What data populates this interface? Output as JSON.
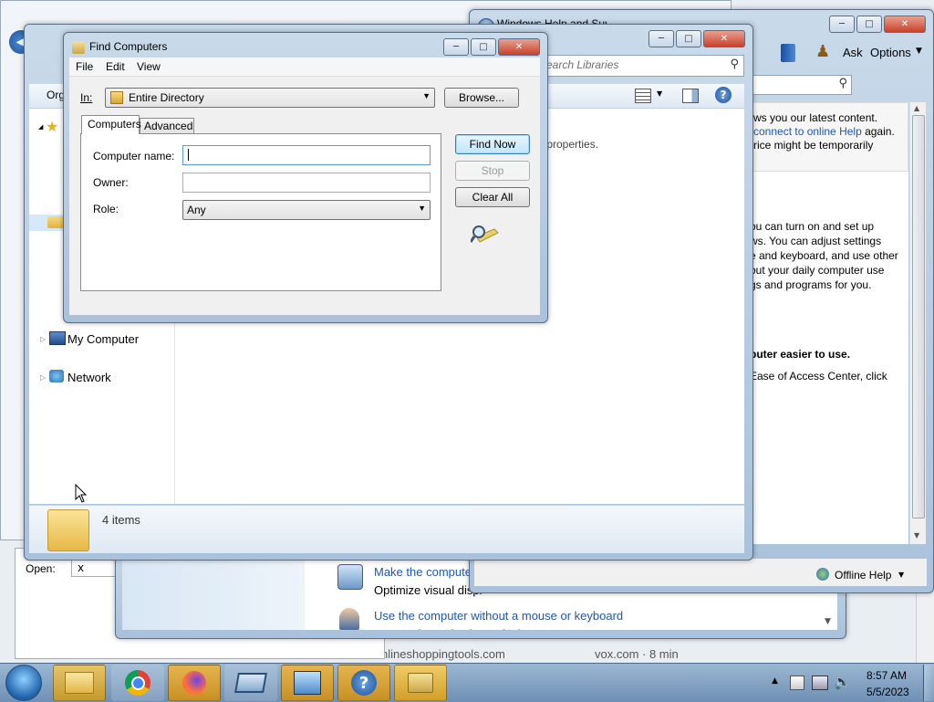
{
  "desktop": {
    "bottom_left_text": "nlineshoppingtools.com",
    "bottom_mid_text": "vox.com · 8 min"
  },
  "run_dialog": {
    "open_label": "Open:",
    "open_value": "x"
  },
  "help_window": {
    "title": "Windows Help and Support",
    "ask_label": "Ask",
    "options_label": "Options",
    "offline_label": "Offline Help",
    "lines": [
      "ws you our latest content.",
      "connect to online Help",
      " again.",
      "rice might be temporarily",
      "ou can turn on and set up",
      "ws. You can adjust settings",
      "e and keyboard, and use other",
      "out your daily computer use",
      "gs and programs for you.",
      "puter easier to use.",
      "Ease of Access Center, click"
    ]
  },
  "ease_window": {
    "items": [
      {
        "link": "Make the computer",
        "desc": "Optimize visual displ"
      },
      {
        "link": "Use the computer without a mouse or keyboard",
        "desc": "Set up alternative input devices"
      }
    ]
  },
  "explorer": {
    "search_placeholder": "Search Libraries",
    "organize_label": "Org",
    "properties_text": "r properties.",
    "tree": [
      {
        "label": "My Computer"
      },
      {
        "label": "Network"
      }
    ],
    "status_text": "4 items"
  },
  "find_dialog": {
    "title": "Find Computers",
    "menu": [
      "File",
      "Edit",
      "View"
    ],
    "in_label": "In:",
    "in_value": "Entire Directory",
    "browse_label": "Browse...",
    "tabs": [
      "Computers",
      "Advanced"
    ],
    "computer_name_label": "Computer name:",
    "computer_name_value": "",
    "owner_label": "Owner:",
    "owner_value": "",
    "role_label": "Role:",
    "role_value": "Any",
    "find_now_label": "Find Now",
    "stop_label": "Stop",
    "clear_all_label": "Clear All"
  },
  "taskbar": {
    "time": "8:57 AM",
    "date": "5/5/2023"
  }
}
